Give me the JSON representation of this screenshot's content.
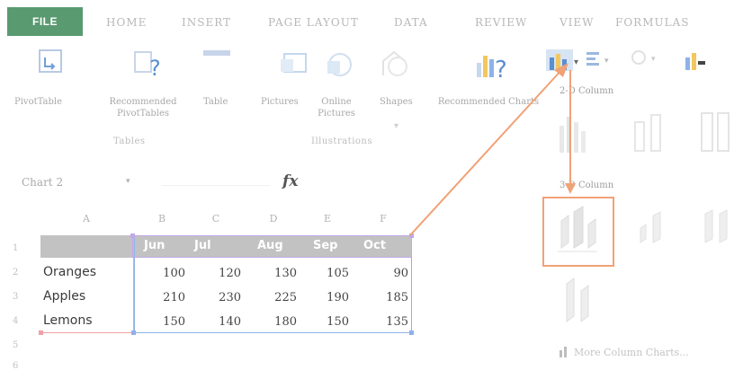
{
  "ribbon_tabs": [
    "FILE",
    "HOME",
    "INSERT",
    "PAGE LAYOUT",
    "DATA",
    "REVIEW",
    "VIEW",
    "FORMULAS"
  ],
  "ribbon": {
    "pivot_table": "PivotTable",
    "recommended_pivot": "Recommended PivotTables",
    "table": "Table",
    "pictures": "Pictures",
    "online_pictures": "Online Pictures",
    "shapes": "Shapes",
    "recommended_charts": "Recommended Charts",
    "group_tables": "Tables",
    "group_illustrations": "Illustrations"
  },
  "formula_bar": {
    "name_box": "Chart 2",
    "fx": "fx"
  },
  "sheet": {
    "column_headers": [
      "A",
      "B",
      "C",
      "D",
      "E",
      "F"
    ],
    "row_numbers": [
      "1",
      "2",
      "3",
      "4",
      "5",
      "6"
    ],
    "months": [
      "Jun",
      "Jul",
      "Aug",
      "Sep",
      "Oct"
    ],
    "rows": [
      {
        "label": "Oranges",
        "values": [
          "100",
          "120",
          "130",
          "105",
          "90"
        ]
      },
      {
        "label": "Apples",
        "values": [
          "210",
          "230",
          "225",
          "190",
          "185"
        ]
      },
      {
        "label": "Lemons",
        "values": [
          "150",
          "140",
          "180",
          "150",
          "135"
        ]
      }
    ]
  },
  "dropdown": {
    "section_2d": "2-D Column",
    "section_3d": "3-D Column",
    "more_link": "More Column Charts..."
  },
  "colors": {
    "file_tab": "#5a9a71",
    "arrow": "#f0a277",
    "data_range": "#8fb2e8",
    "label_range": "#f0a0a8",
    "header_range": "#c0a8e8"
  }
}
